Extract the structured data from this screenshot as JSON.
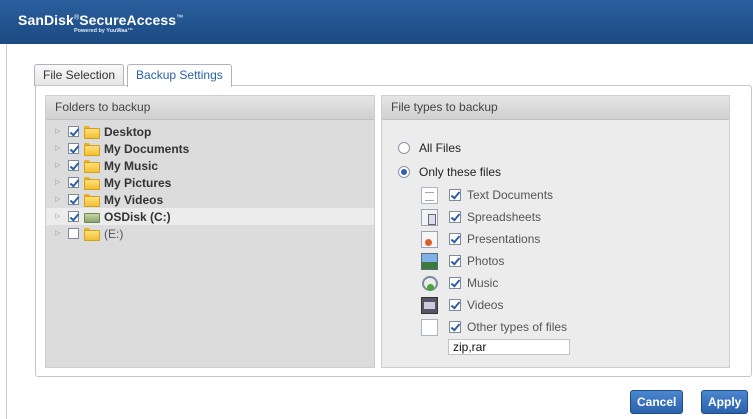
{
  "app": {
    "brand_prefix": "SanDisk",
    "brand_registered": "®",
    "brand_name": "SecureAccess",
    "brand_tm": "™",
    "brand_sub": "Powered by YuuWaa™"
  },
  "tabs": [
    {
      "label": "File Selection",
      "active": false
    },
    {
      "label": "Backup Settings",
      "active": true
    }
  ],
  "folders": {
    "header": "Folders to backup",
    "items": [
      {
        "label": "Desktop",
        "checked": true
      },
      {
        "label": "My Documents",
        "checked": true
      },
      {
        "label": "My Music",
        "checked": true
      },
      {
        "label": "My Pictures",
        "checked": true
      },
      {
        "label": "My Videos",
        "checked": true
      },
      {
        "label": "OSDisk (C:)",
        "checked": true
      },
      {
        "label": "(E:)",
        "checked": false
      }
    ]
  },
  "file_types": {
    "header": "File types to backup",
    "all_files_label": "All Files",
    "only_these_label": "Only these files",
    "selected": "only_these",
    "types": [
      {
        "label": "Text Documents",
        "icon": "text-document-icon",
        "checked": true
      },
      {
        "label": "Spreadsheets",
        "icon": "spreadsheet-icon",
        "checked": true
      },
      {
        "label": "Presentations",
        "icon": "presentation-icon",
        "checked": true
      },
      {
        "label": "Photos",
        "icon": "photo-icon",
        "checked": true
      },
      {
        "label": "Music",
        "icon": "music-icon",
        "checked": true
      },
      {
        "label": "Videos",
        "icon": "video-icon",
        "checked": true
      },
      {
        "label": "Other types of files",
        "icon": "other-file-icon",
        "checked": true
      }
    ],
    "other_extensions": "zip,rar"
  },
  "buttons": {
    "cancel": "Cancel",
    "apply": "Apply"
  }
}
